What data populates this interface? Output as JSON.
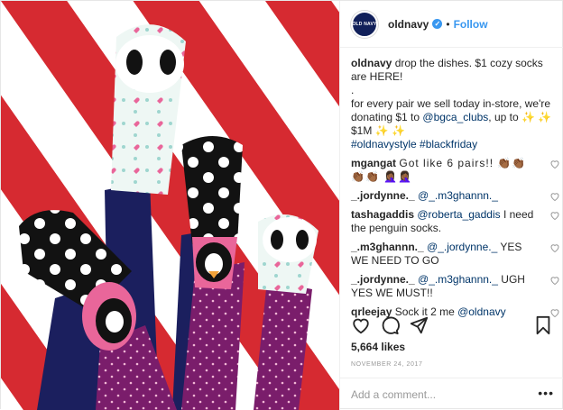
{
  "colors": {
    "accent": "#3897f0",
    "mention": "#003569",
    "stripe": "#d62a31",
    "tights": "#1b1f5e",
    "leg_purple": "#7a1d6b",
    "sock_pink": "#e9669a"
  },
  "header": {
    "avatar_text": "OLD NAVY",
    "username": "oldnavy",
    "verified_icon": "verified-badge-icon",
    "separator": "•",
    "follow_label": "Follow"
  },
  "caption": {
    "user": "oldnavy",
    "line1": "drop the dishes. $1 cozy socks are HERE!",
    "dot": ".",
    "line2a": "for every pair we sell today in-store, we're donating $1 to ",
    "mention": "@bgca_clubs",
    "line2b": ", up to ✨ ✨ $1M ✨ ✨",
    "hashtags": "#oldnavystyle #blackfriday"
  },
  "comments": [
    {
      "user": "mgangat",
      "text": "Got like 6 pairs!! 👏🏾👏🏾👏🏾👏🏾 🤦🏾‍♀️🤦🏾‍♀️",
      "mention": ""
    },
    {
      "user": "_.jordynne._",
      "text": "",
      "mention": "@_.m3ghannn._"
    },
    {
      "user": "tashagaddis",
      "text": " I need the penguin socks.",
      "mention": "@roberta_gaddis"
    },
    {
      "user": "_.m3ghannn._",
      "text": " YES WE NEED TO GO",
      "mention": "@_.jordynne._"
    },
    {
      "user": "_.jordynne._",
      "text": " UGH YES WE MUST!!",
      "mention": "@_.m3ghannn._"
    },
    {
      "user": "qrleejay",
      "text": "Sock it 2 me ",
      "mention": "@oldnavy"
    }
  ],
  "actions": {
    "like_icon": "heart-icon",
    "comment_icon": "comment-icon",
    "share_icon": "share-icon",
    "save_icon": "bookmark-icon"
  },
  "likes": "5,664 likes",
  "date": "NOVEMBER 24, 2017",
  "add_comment": {
    "placeholder": "Add a comment...",
    "more_label": "•••"
  }
}
